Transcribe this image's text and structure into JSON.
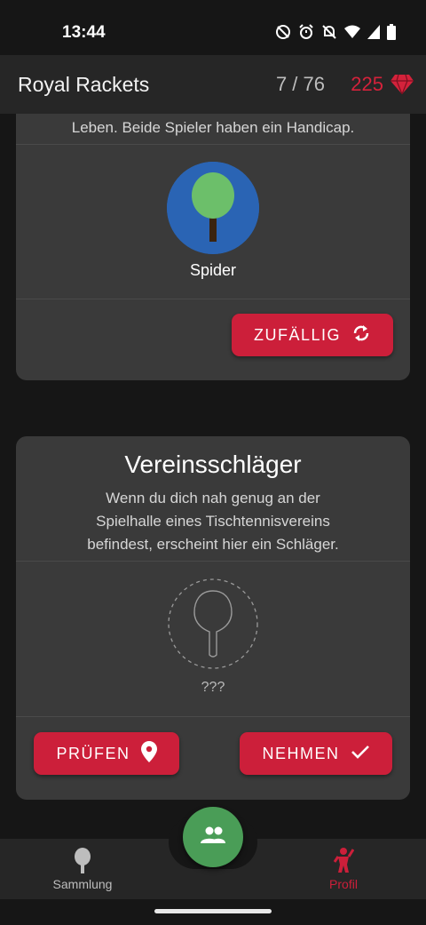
{
  "status_bar": {
    "time": "13:44"
  },
  "app_bar": {
    "title": "Royal Rackets",
    "count": "7 / 76",
    "gems": "225"
  },
  "card1": {
    "description_tail": "Leben. Beide Spieler haben ein Handicap.",
    "racket_name": "Spider",
    "random_button": "ZUFÄLLIG"
  },
  "card2": {
    "title": "Vereinsschläger",
    "description_line1": "Wenn du dich nah genug an der",
    "description_line2": "Spielhalle eines Tischtennisvereins",
    "description_line3": "befindest, erscheint hier ein Schläger.",
    "racket_unknown": "???",
    "check_button": "PRÜFEN",
    "take_button": "NEHMEN"
  },
  "bottom_nav": {
    "collection_label": "Sammlung",
    "profile_label": "Profil"
  },
  "colors": {
    "accent": "#cc1f3a",
    "fab": "#4a9d57",
    "card": "#3a3a3a"
  }
}
